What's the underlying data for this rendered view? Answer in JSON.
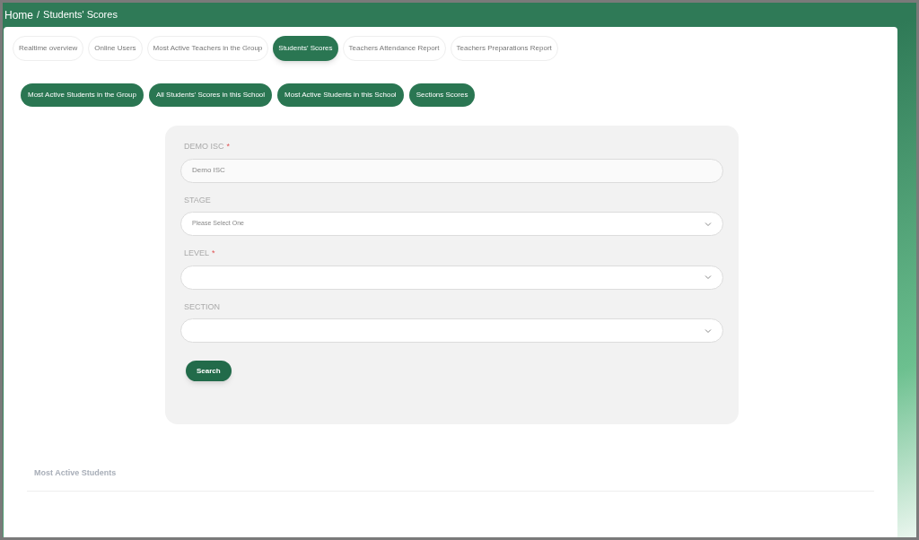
{
  "breadcrumb": {
    "items": [
      "Home",
      "Students' Scores"
    ],
    "separator": "/"
  },
  "tabs": [
    {
      "label": "Realtime overview",
      "selected": false
    },
    {
      "label": "Online Users",
      "selected": false
    },
    {
      "label": "Most Active Teachers in the Group",
      "selected": false
    },
    {
      "label": "Students' Scores",
      "selected": true
    },
    {
      "label": "Teachers Attendance Report",
      "selected": false
    },
    {
      "label": "Teachers Preparations Report",
      "selected": false
    }
  ],
  "report_buttons": [
    "Most Active Students in the Group",
    "All Students' Scores in this School",
    "Most Active Students in this School",
    "Sections Scores"
  ],
  "form": {
    "fields": [
      {
        "label": "DEMO ISC",
        "required_mark": "*",
        "kind": "input",
        "value": "Demo ISC"
      },
      {
        "label": "STAGE",
        "kind": "select",
        "value": "Please Select One"
      },
      {
        "label": "LEVEL",
        "required_mark": "*",
        "kind": "select"
      },
      {
        "label": "SECTION",
        "kind": "select"
      }
    ],
    "submit": "Search"
  },
  "section_title": "Most Active Students"
}
